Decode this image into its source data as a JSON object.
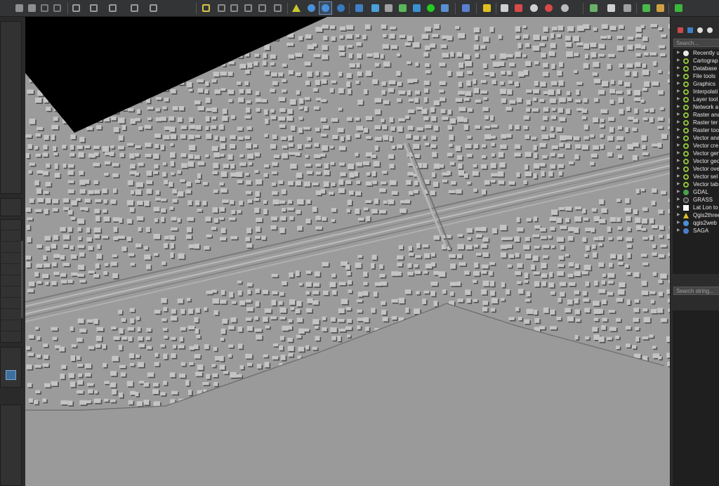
{
  "toolbar": {
    "buttons": [
      {
        "name": "save-as-icon",
        "color": "#8f8f8f"
      },
      {
        "name": "print-layout-icon",
        "color": "#8f8f8f"
      },
      {
        "name": "undo-icon",
        "color": "#7a7a7a"
      },
      {
        "name": "redo-icon",
        "color": "#7a7a7a"
      },
      {
        "name": "digitize-node-icon",
        "color": "#9a9a9a"
      },
      {
        "name": "add-point-icon",
        "color": "#9a9a9a"
      },
      {
        "name": "add-line-icon",
        "color": "#9a9a9a"
      },
      {
        "name": "add-polygon-icon",
        "color": "#9a9a9a"
      },
      {
        "name": "vertex-tool-icon",
        "color": "#9a9a9a"
      },
      {
        "name": "label-abc-icon",
        "color": "#d9c24a"
      },
      {
        "name": "label-move-icon",
        "color": "#8a8a8a"
      },
      {
        "name": "label-rotate-icon",
        "color": "#8a8a8a"
      },
      {
        "name": "label-change-icon",
        "color": "#8a8a8a"
      },
      {
        "name": "label-pin-icon",
        "color": "#8a8a8a"
      },
      {
        "name": "label-show-icon",
        "color": "#8a8a8a"
      },
      {
        "name": "measure-triangle-icon",
        "color": "#c8c830"
      },
      {
        "name": "globe-icon",
        "color": "#4a90d9"
      },
      {
        "name": "globe-grid-icon",
        "color": "#4a90d9"
      },
      {
        "name": "earth-view-icon",
        "color": "#3a78c0"
      },
      {
        "name": "python-icon",
        "color": "#3f7fc4"
      },
      {
        "name": "elevation-icon",
        "color": "#4aa0d8"
      },
      {
        "name": "tower-icon",
        "color": "#a0a0a0"
      },
      {
        "name": "cube-icon",
        "color": "#58b858"
      },
      {
        "name": "network-icon",
        "color": "#3a90d0"
      },
      {
        "name": "green-circle-icon",
        "color": "#22cc22"
      },
      {
        "name": "grid-icon",
        "color": "#5a8fd0"
      },
      {
        "name": "help-icon",
        "color": "#5a7fd0"
      },
      {
        "name": "s-plugin-icon",
        "color": "#e0c020"
      },
      {
        "name": "copy-icon",
        "color": "#cfcfcf"
      },
      {
        "name": "map-pin-icon",
        "color": "#d84a4a"
      },
      {
        "name": "zoom-icon",
        "color": "#d0d0d0"
      },
      {
        "name": "zoom-red-icon",
        "color": "#d84a4a"
      },
      {
        "name": "globe-wire-icon",
        "color": "#bbbbbb"
      },
      {
        "name": "select-frame-icon",
        "color": "#6ab06a"
      },
      {
        "name": "tiger-icon",
        "color": "#d0d0d0"
      },
      {
        "name": "brush-icon",
        "color": "#a0a0a0"
      },
      {
        "name": "search-green-icon",
        "color": "#4ab84a"
      },
      {
        "name": "edit-pencil-icon",
        "color": "#d0a040"
      },
      {
        "name": "plugin-green-icon",
        "color": "#3ab83a"
      }
    ]
  },
  "toolbox": {
    "search_placeholder": "Search...",
    "results_search_placeholder": "Search string...",
    "header_icons": [
      {
        "name": "processing-models-icon",
        "color": "#c84a4a"
      },
      {
        "name": "python-scripts-icon",
        "color": "#3f7fc4"
      },
      {
        "name": "history-clock-icon",
        "color": "#dddddd"
      },
      {
        "name": "options-icon",
        "color": "#dddddd"
      }
    ],
    "items": [
      {
        "label": "Recently u",
        "icon": "clock-icon",
        "color": "#e8e8e8"
      },
      {
        "label": "Cartograp",
        "icon": "qgis-logo-icon",
        "color": "#8fc53a"
      },
      {
        "label": "Database",
        "icon": "qgis-logo-icon",
        "color": "#8fc53a"
      },
      {
        "label": "File tools",
        "icon": "qgis-logo-icon",
        "color": "#8fc53a"
      },
      {
        "label": "Graphics",
        "icon": "qgis-logo-icon",
        "color": "#8fc53a"
      },
      {
        "label": "Interpolati",
        "icon": "qgis-logo-icon",
        "color": "#8fc53a"
      },
      {
        "label": "Layer tool",
        "icon": "qgis-logo-icon",
        "color": "#8fc53a"
      },
      {
        "label": "Network a",
        "icon": "qgis-logo-icon",
        "color": "#8fc53a"
      },
      {
        "label": "Raster ana",
        "icon": "qgis-logo-icon",
        "color": "#8fc53a"
      },
      {
        "label": "Raster ter",
        "icon": "qgis-logo-icon",
        "color": "#8fc53a"
      },
      {
        "label": "Raster too",
        "icon": "qgis-logo-icon",
        "color": "#8fc53a"
      },
      {
        "label": "Vector ana",
        "icon": "qgis-logo-icon",
        "color": "#8fc53a"
      },
      {
        "label": "Vector cre",
        "icon": "qgis-logo-icon",
        "color": "#8fc53a"
      },
      {
        "label": "Vector gen",
        "icon": "qgis-logo-icon",
        "color": "#8fc53a"
      },
      {
        "label": "Vector geo",
        "icon": "qgis-logo-icon",
        "color": "#8fc53a"
      },
      {
        "label": "Vector ove",
        "icon": "qgis-logo-icon",
        "color": "#8fc53a"
      },
      {
        "label": "Vector sel",
        "icon": "qgis-logo-icon",
        "color": "#8fc53a"
      },
      {
        "label": "Vector tab",
        "icon": "qgis-logo-icon",
        "color": "#8fc53a"
      },
      {
        "label": "GDAL",
        "icon": "gdal-icon",
        "color": "#4aa04a"
      },
      {
        "label": "GRASS",
        "icon": "grass-icon",
        "color": "#3a3a3a"
      },
      {
        "label": "Lat Lon to",
        "icon": "document-icon",
        "color": "#ffffff"
      },
      {
        "label": "Qgis2three",
        "icon": "triangle-icon",
        "color": "#d8c030"
      },
      {
        "label": "qgis2web",
        "icon": "gear-icon",
        "color": "#4a90d9"
      },
      {
        "label": "SAGA",
        "icon": "saga-icon",
        "color": "#4a7fc8"
      }
    ]
  }
}
